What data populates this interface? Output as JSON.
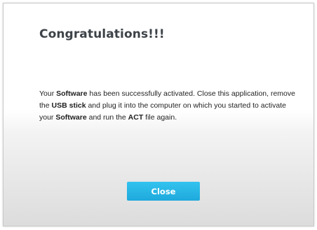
{
  "dialog": {
    "title": "Congratulations!!!",
    "message": {
      "line1_a": "Your ",
      "line1_b": "Software",
      "line1_c": " has been successfully activated.  Close this application, remove the ",
      "line1_d": "USB stick",
      "line1_e": " and plug it into the computer on which you started to activate your ",
      "line1_f": "Software",
      "line1_g": " and run the ",
      "line1_h": "ACT",
      "line1_i": " file again."
    },
    "close_label": "Close"
  },
  "colors": {
    "button": "#26b4e4",
    "title": "#3c4247"
  }
}
